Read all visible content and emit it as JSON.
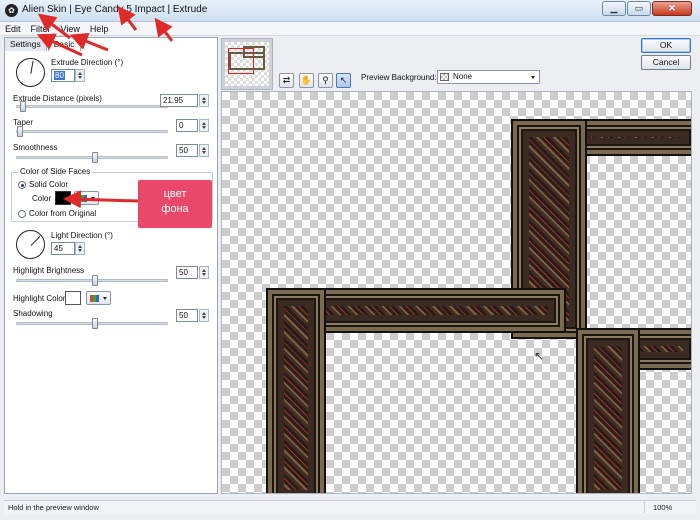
{
  "window": {
    "title": "Alien Skin | Eye Candy 5 Impact | Extrude"
  },
  "menu": [
    "Edit",
    "Filter",
    "View",
    "Help"
  ],
  "tabs": [
    "Settings",
    "Basic"
  ],
  "basic": {
    "extrude_direction_label": "Extrude Direction (°)",
    "extrude_direction_value": "80",
    "extrude_distance_label": "Extrude Distance (pixels)",
    "extrude_distance_value": "21.95",
    "taper_label": "Taper",
    "taper_value": "0",
    "smoothness_label": "Smoothness",
    "smoothness_value": "50",
    "side_faces_group": "Color of Side Faces",
    "solid_color_label": "Solid Color",
    "color_label": "Color",
    "from_original_label": "Color from Original",
    "light_direction_label": "Light Direction (°)",
    "light_direction_value": "45",
    "highlight_brightness_label": "Highlight Brightness",
    "highlight_brightness_value": "50",
    "highlight_color_label": "Highlight Color",
    "shadowing_label": "Shadowing",
    "shadowing_value": "50"
  },
  "colors": {
    "side_face_color": "#000000",
    "highlight_color": "#ffffff",
    "annotation": "#e8483e"
  },
  "buttons": {
    "ok": "OK",
    "cancel": "Cancel"
  },
  "preview_background": {
    "label": "Preview Background:",
    "value": "None"
  },
  "toolbar_icons": [
    "preview-toggle-icon",
    "hand-icon",
    "zoom-icon",
    "pointer-icon"
  ],
  "callout": {
    "line1": "цвет",
    "line2": "фона"
  },
  "status": {
    "hint": "Hold in the preview window",
    "zoom": "100%"
  }
}
